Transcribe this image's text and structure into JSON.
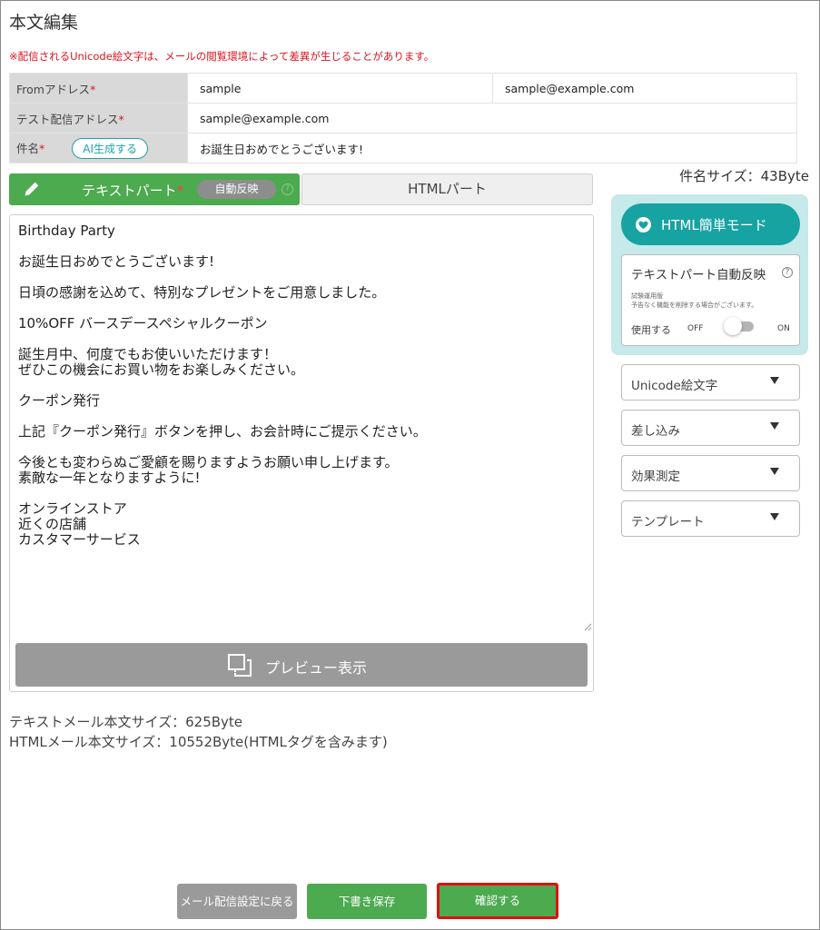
{
  "page": {
    "title": "本文編集",
    "notice": "※配信されるUnicode絵文字は、メールの閲覧環境によって差異が生じることがあります。"
  },
  "header": {
    "from_label": "Fromアドレス",
    "from_name": "sample",
    "from_address": "sample@example.com",
    "test_label": "テスト配信アドレス",
    "test_address": "sample@example.com",
    "subject_label": "件名",
    "ai_button": "AI生成する",
    "subject_value": "お誕生日おめでとうございます!",
    "required_mark": "*"
  },
  "subject_size": "件名サイズ：43Byte",
  "tabs": {
    "text_part": "テキストパート",
    "auto_reflect": "自動反映",
    "help": "?",
    "html_part": "HTMLパート"
  },
  "editor": {
    "body": "Birthday Party\n\nお誕生日おめでとうございます!\n\n日頃の感謝を込めて、特別なプレゼントをご用意しました。\n\n10%OFF バースデースペシャルクーポン\n\n誕生月中、何度でもお使いいただけます！\nぜひこの機会にお買い物をお楽しみください。\n\nクーポン発行\n\n上記『クーポン発行』ボタンを押し、お会計時にご提示ください。\n\n今後とも変わらぬご愛顧を賜りますようお願い申し上げます。\n素敵な一年となりますように!\n\nオンラインストア\n近くの店舗\nカスタマーサービス",
    "preview_button": "プレビュー表示"
  },
  "size_info": {
    "text_size": "テキストメール本文サイズ：625Byte",
    "html_size": "HTMLメール本文サイズ：10552Byte(HTMLタグを含みます)"
  },
  "side": {
    "html_mode_button": "HTML簡単モード",
    "auto_title": "テキストパート自動反映",
    "auto_help": "?",
    "note_line1": "試験運用版",
    "note_line2": "予告なく機能を削除する場合がございます。",
    "use_label": "使用する",
    "off_label": "OFF",
    "on_label": "ON",
    "toggle_on": false,
    "dropdowns": [
      "Unicode絵文字",
      "差し込み",
      "効果測定",
      "テンプレート"
    ]
  },
  "footer": {
    "back_button": "メール配信設定に戻る",
    "draft_button": "下書き保存",
    "confirm_button": "確認する"
  },
  "colors": {
    "green": "#4caa4f",
    "teal": "#16a3a2",
    "panel_bg": "#c6e9ea",
    "gray_button": "#9a9a9a",
    "required_red": "#e0141e",
    "highlight_red": "#e01010"
  }
}
